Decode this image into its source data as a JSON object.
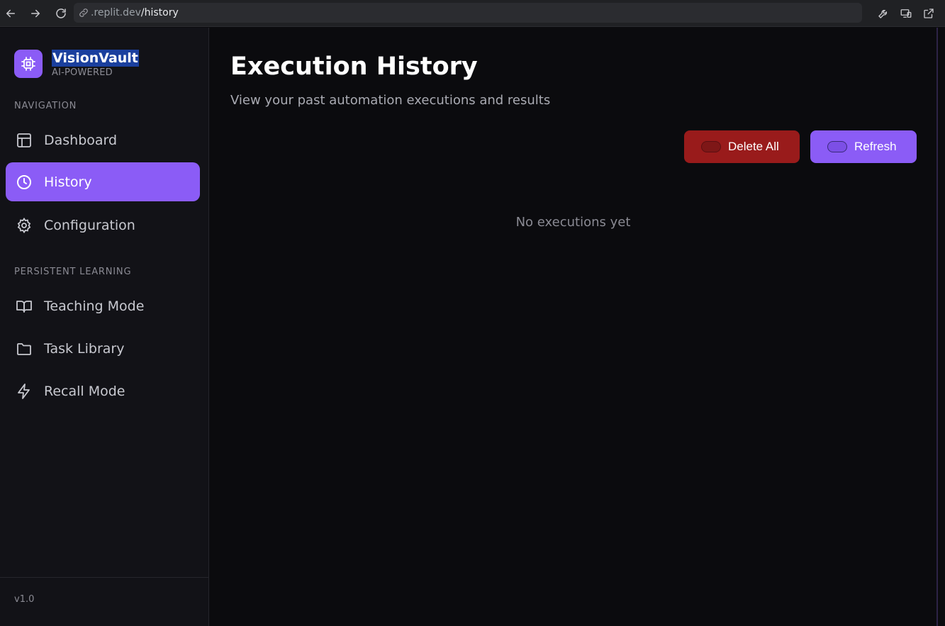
{
  "browser": {
    "url_domain": ".replit.dev",
    "url_path": "/history"
  },
  "brand": {
    "name": "VisionVault",
    "subtitle": "AI-POWERED"
  },
  "sidebar": {
    "navigation_label": "NAVIGATION",
    "nav_items": [
      {
        "label": "Dashboard",
        "icon": "layout-icon"
      },
      {
        "label": "History",
        "icon": "clock-icon",
        "active": true
      },
      {
        "label": "Configuration",
        "icon": "gear-icon"
      }
    ],
    "learning_label": "PERSISTENT LEARNING",
    "learning_items": [
      {
        "label": "Teaching Mode",
        "icon": "book-icon"
      },
      {
        "label": "Task Library",
        "icon": "folder-icon"
      },
      {
        "label": "Recall Mode",
        "icon": "lightning-icon"
      }
    ],
    "version": "v1.0"
  },
  "main": {
    "title": "Execution History",
    "subtitle": "View your past automation executions and results",
    "delete_all_label": "Delete All",
    "refresh_label": "Refresh",
    "empty_text": "No executions yet"
  },
  "colors": {
    "accent": "#8b5cf6",
    "danger": "#991b1b",
    "background": "#0b0b0e",
    "sidebar": "#121217"
  }
}
